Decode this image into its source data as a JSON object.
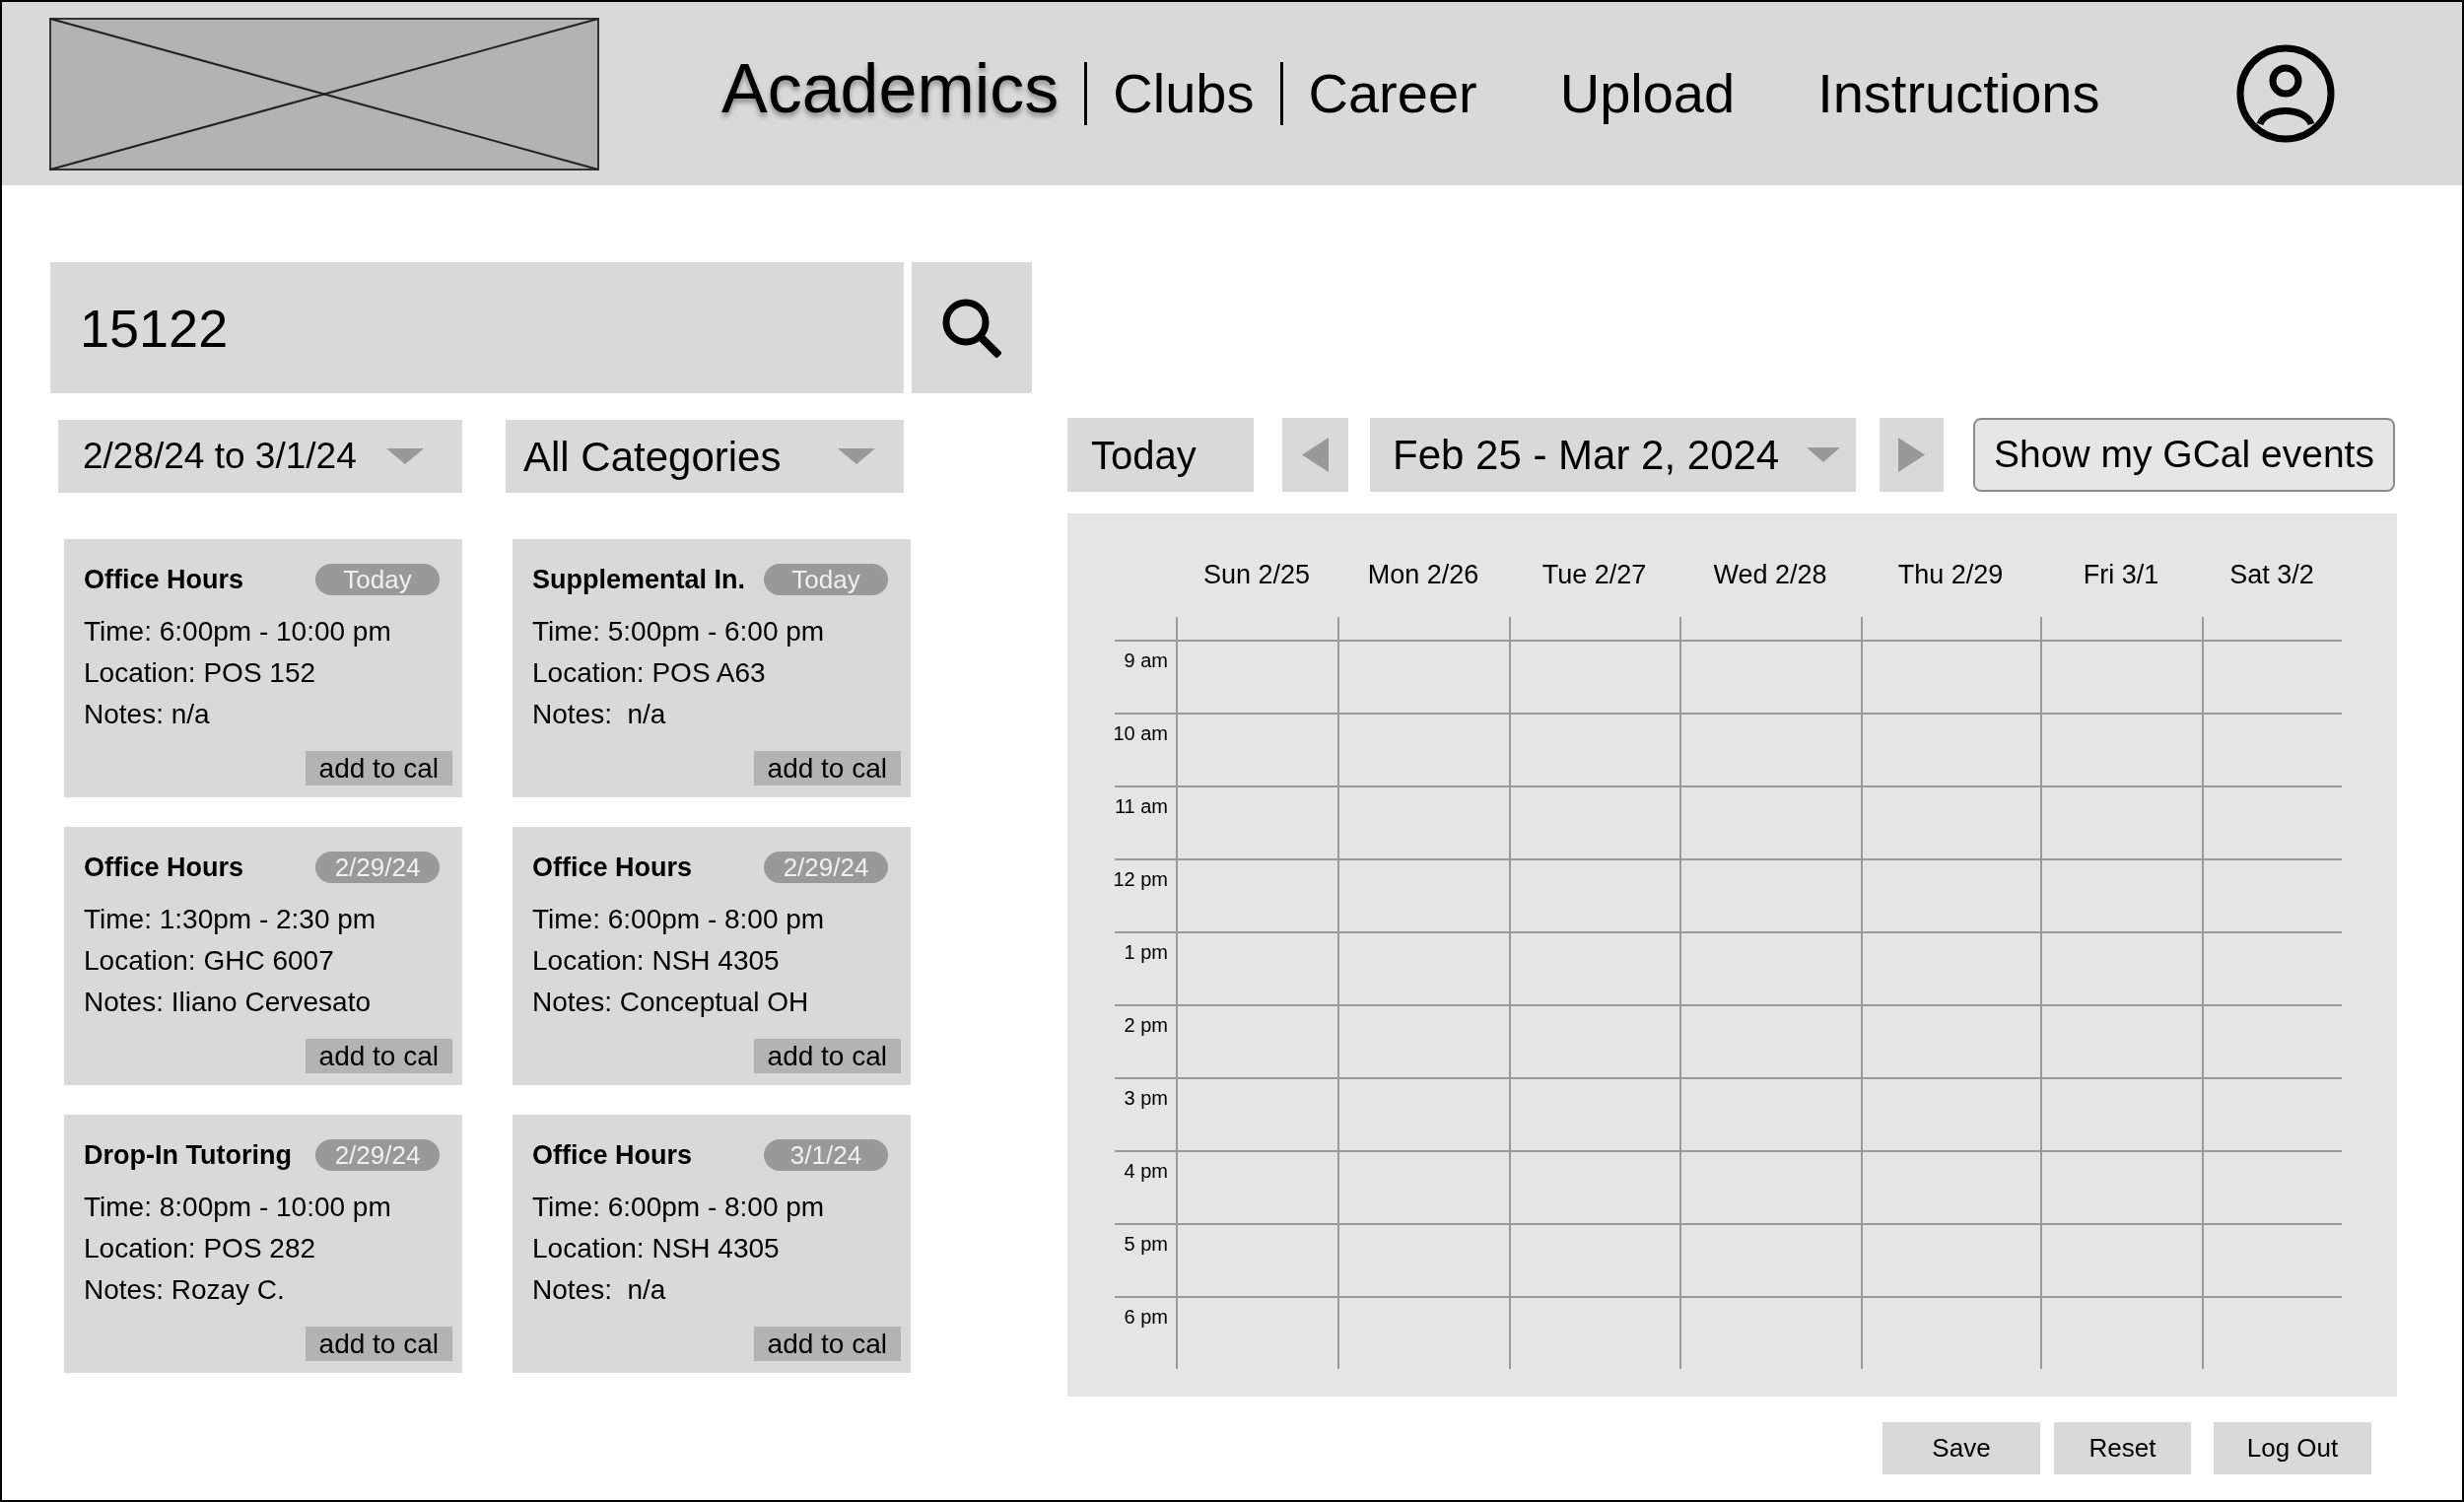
{
  "nav": {
    "tabs": [
      {
        "label": "Academics",
        "selected": true
      },
      {
        "label": "Clubs",
        "selected": false
      },
      {
        "label": "Career",
        "selected": false
      }
    ],
    "links": [
      "Upload",
      "Instructions"
    ]
  },
  "search": {
    "value": "15122"
  },
  "filters": {
    "date_range": "2/28/24 to 3/1/24",
    "category": "All Categories"
  },
  "events": [
    {
      "title": "Office Hours",
      "date": "Today",
      "time": "Time: 6:00pm - 10:00 pm",
      "location": "Location: POS 152",
      "notes": "Notes: n/a",
      "action": "add to cal"
    },
    {
      "title": "Supplemental In.",
      "date": "Today",
      "time": "Time: 5:00pm - 6:00 pm",
      "location": "Location: POS A63",
      "notes": "Notes:  n/a",
      "action": "add to cal"
    },
    {
      "title": "Office Hours",
      "date": "2/29/24",
      "time": "Time: 1:30pm - 2:30 pm",
      "location": "Location: GHC 6007",
      "notes": "Notes: Iliano Cervesato",
      "action": "add to cal"
    },
    {
      "title": "Office Hours",
      "date": "2/29/24",
      "time": "Time: 6:00pm - 8:00 pm",
      "location": "Location: NSH 4305",
      "notes": "Notes: Conceptual OH",
      "action": "add to cal"
    },
    {
      "title": "Drop-In Tutoring",
      "date": "2/29/24",
      "time": "Time: 8:00pm - 10:00 pm",
      "location": "Location: POS 282",
      "notes": "Notes: Rozay C.",
      "action": "add to cal"
    },
    {
      "title": "Office Hours",
      "date": "3/1/24",
      "time": "Time: 6:00pm - 8:00 pm",
      "location": "Location: NSH 4305",
      "notes": "Notes:  n/a",
      "action": "add to cal"
    }
  ],
  "calendar": {
    "today_button": "Today",
    "range": "Feb 25 - Mar 2, 2024",
    "gcal_button": "Show my GCal events",
    "days": [
      "Sun 2/25",
      "Mon 2/26",
      "Tue 2/27",
      "Wed 2/28",
      "Thu 2/29",
      "Fri 3/1",
      "Sat 3/2"
    ],
    "hours": [
      "9 am",
      "10 am",
      "11 am",
      "12 pm",
      "1 pm",
      "2 pm",
      "3 pm",
      "4 pm",
      "5 pm",
      "6 pm"
    ]
  },
  "buttons": [
    "Save",
    "Reset",
    "Log Out"
  ]
}
